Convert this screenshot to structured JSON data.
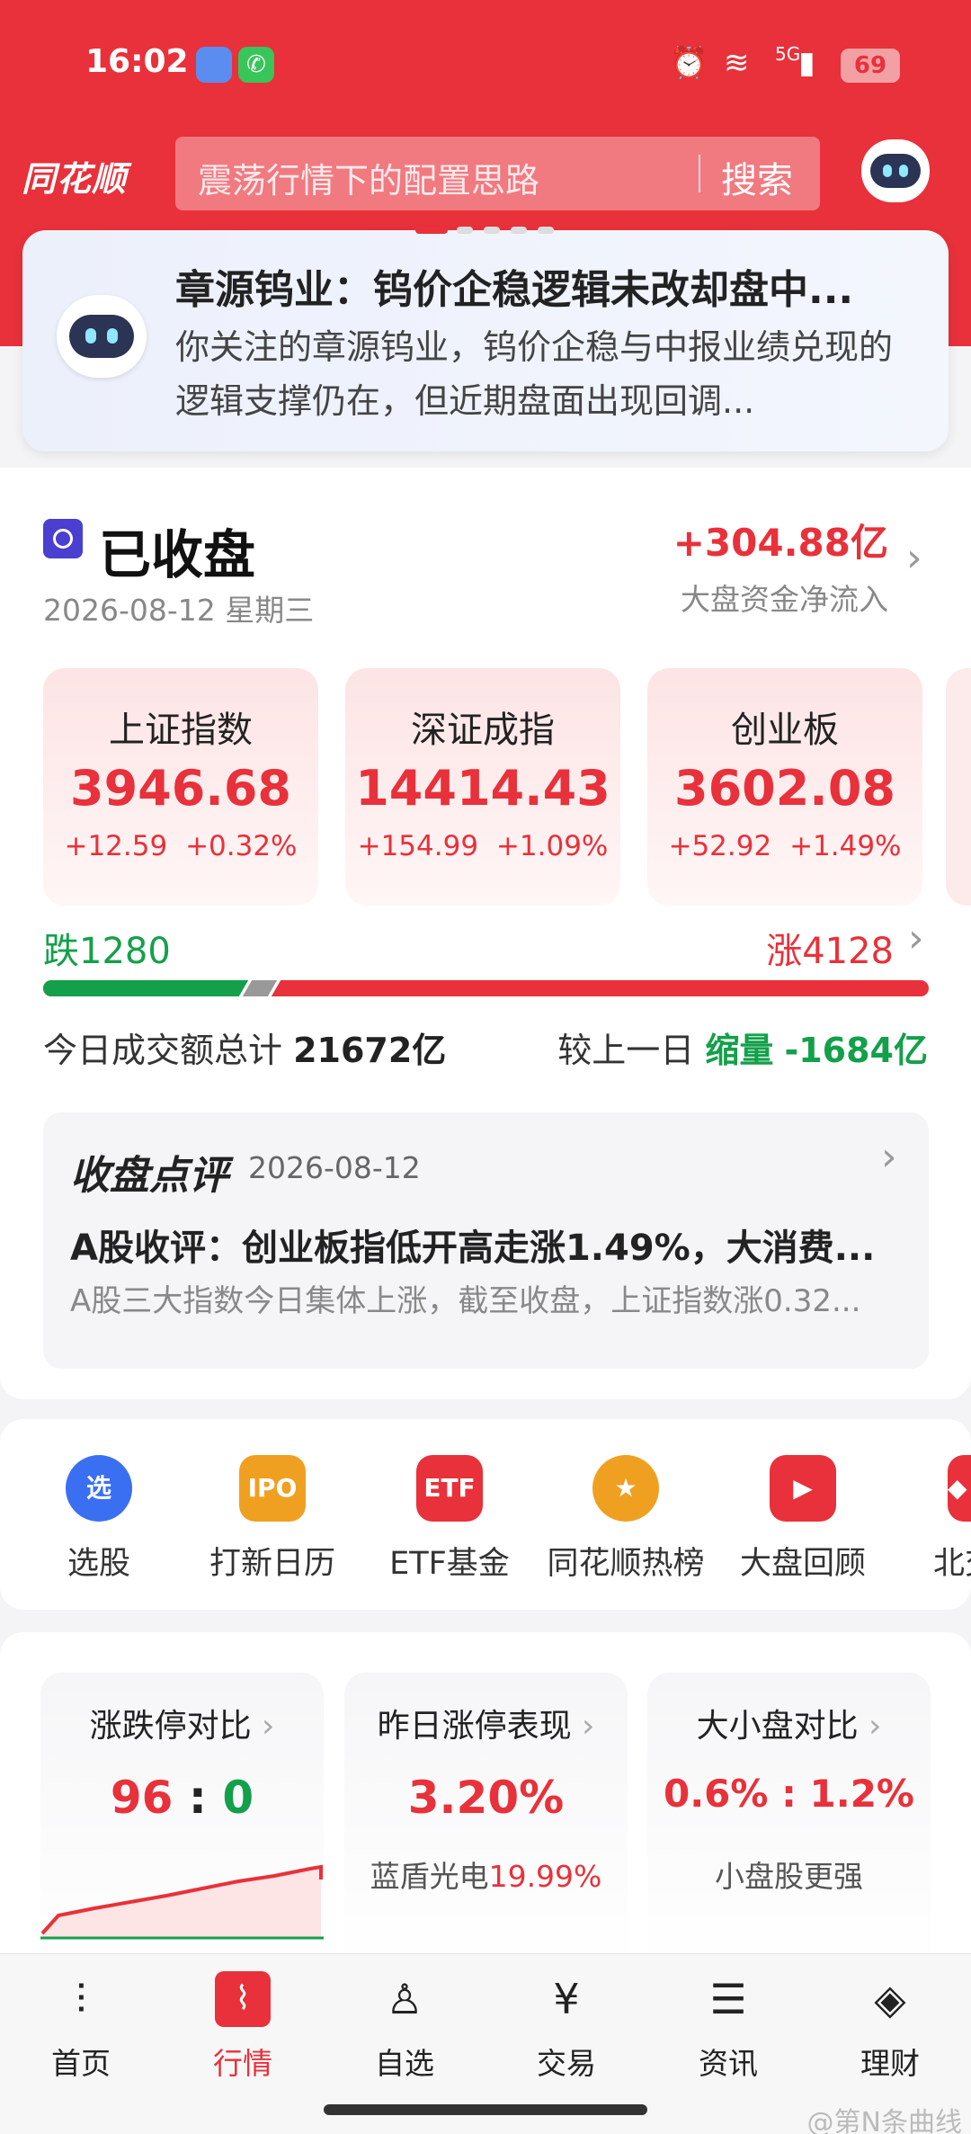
{
  "status_bar": {
    "time": "16:02",
    "battery": "69",
    "network": "5G"
  },
  "header": {
    "logo": "同花顺",
    "search_placeholder": "震荡行情下的配置思路",
    "search_button": "搜索"
  },
  "notice": {
    "title": "章源钨业：钨价企稳逻辑未改却盘中...",
    "body": "你关注的章源钨业，钨价企稳与中报业绩兑现的逻辑支撑仍在，但近期盘面出现回调..."
  },
  "market": {
    "status": "已收盘",
    "date": "2026-08-12 星期三",
    "net_inflow": "+304.88亿",
    "net_inflow_label": "大盘资金净流入"
  },
  "indices": [
    {
      "name": "上证指数",
      "value": "3946.68",
      "change": "+12.59",
      "pct": "+0.32%"
    },
    {
      "name": "深证成指",
      "value": "14414.43",
      "change": "+154.99",
      "pct": "+1.09%"
    },
    {
      "name": "创业板",
      "value": "3602.08",
      "change": "+52.92",
      "pct": "+1.49%"
    }
  ],
  "breadth": {
    "fall_label": "跌",
    "fall": "1280",
    "rise_label": "涨",
    "rise": "4128",
    "fall_fraction": 0.23
  },
  "volume": {
    "label": "今日成交额总计",
    "total": "21672亿",
    "compare_label": "较上一日",
    "trend": "缩量",
    "diff": "-1684亿"
  },
  "review": {
    "brand": "收盘点评",
    "date": "2026-08-12",
    "title": "A股收评：创业板指低开高走涨1.49%，大消费...",
    "summary": "A股三大指数今日集体上涨，截至收盘，上证指数涨0.32..."
  },
  "shortcuts": [
    {
      "label": "选股",
      "icon": "选",
      "color": "#3b6ff2"
    },
    {
      "label": "打新日历",
      "icon": "IPO",
      "color": "#f0a020"
    },
    {
      "label": "ETF基金",
      "icon": "ETF",
      "color": "#e8313a"
    },
    {
      "label": "同花顺热榜",
      "icon": "★",
      "color": "#f0a020"
    },
    {
      "label": "大盘回顾",
      "icon": "▶",
      "color": "#e8313a"
    },
    {
      "label": "北交",
      "icon": "◆",
      "color": "#e8313a"
    }
  ],
  "cards": [
    {
      "title": "涨跌停对比",
      "up": "96",
      "sep": ":",
      "down": "0"
    },
    {
      "title": "昨日涨停表现",
      "value": "3.20%",
      "sub_name": "蓝盾光电",
      "sub_value": "19.99%"
    },
    {
      "title": "大小盘对比",
      "value": "0.6% : 1.2%",
      "sub": "小盘股更强"
    }
  ],
  "tabs": [
    {
      "label": "首页",
      "icon": "⫶"
    },
    {
      "label": "行情",
      "icon": "⌇"
    },
    {
      "label": "自选",
      "icon": "♙"
    },
    {
      "label": "交易",
      "icon": "¥"
    },
    {
      "label": "资讯",
      "icon": "☰"
    },
    {
      "label": "理财",
      "icon": "◈"
    }
  ],
  "watermark": "@第N条曲线",
  "colors": {
    "brand_red": "#e8313a",
    "down_green": "#14a04a"
  }
}
